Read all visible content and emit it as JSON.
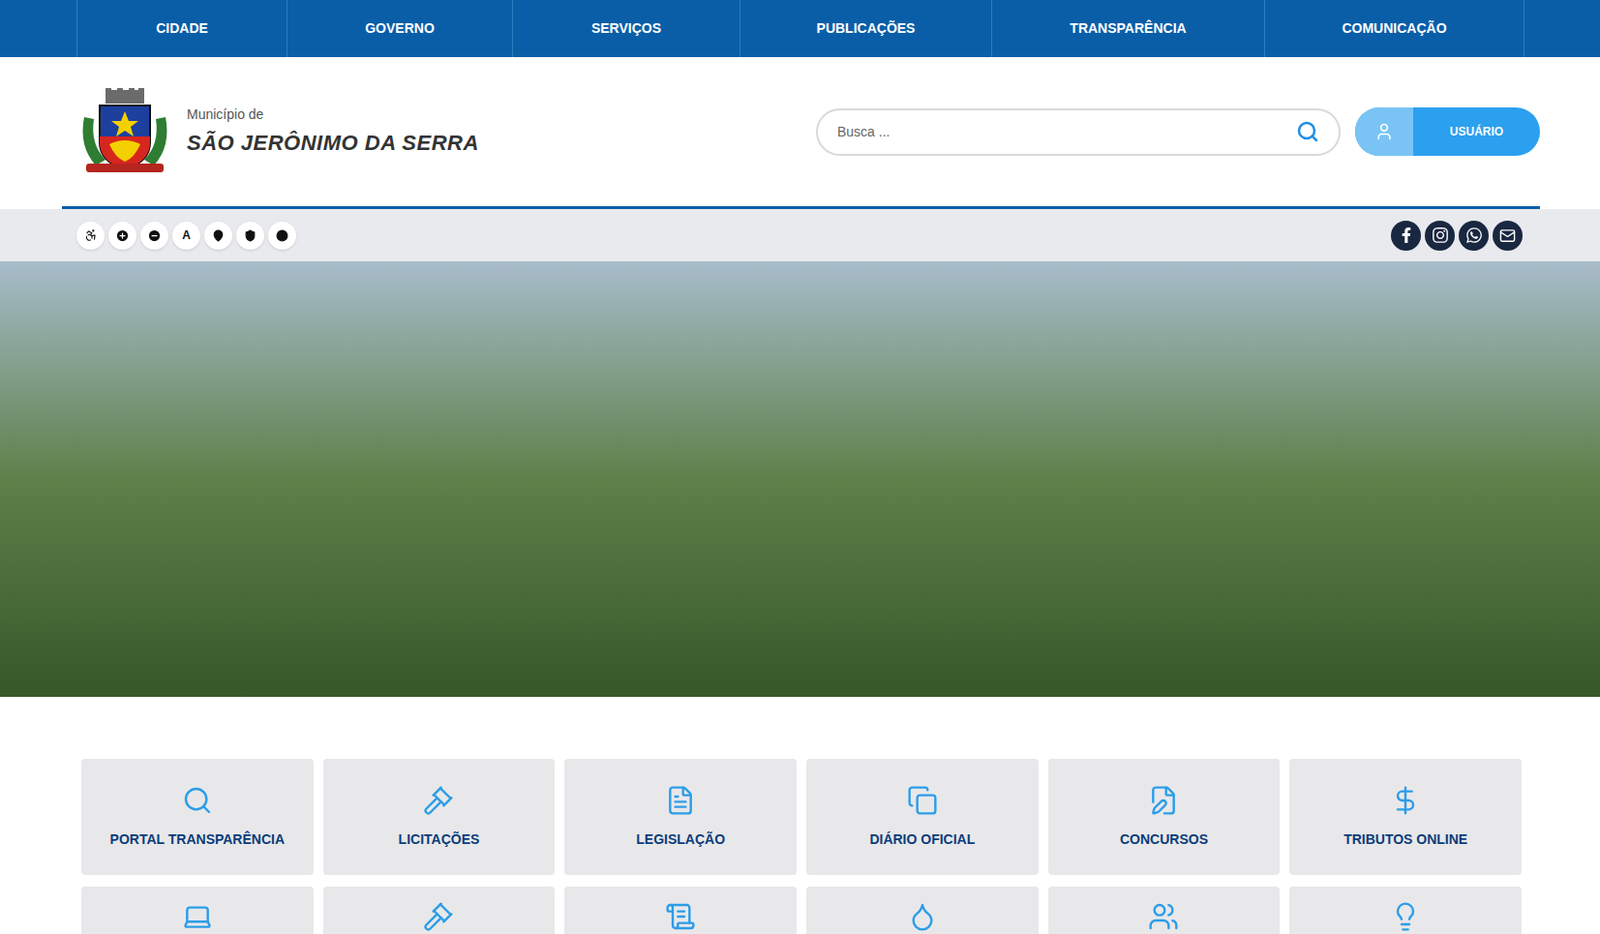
{
  "nav": [
    "CIDADE",
    "GOVERNO",
    "SERVIÇOS",
    "PUBLICAÇÕES",
    "TRANSPARÊNCIA",
    "COMUNICAÇÃO"
  ],
  "municipality": {
    "prefix": "Município de",
    "name": "SÃO JERÔNIMO DA SERRA"
  },
  "search": {
    "placeholder": "Busca ..."
  },
  "user_button": {
    "label": "USUÁRIO"
  },
  "accessibility": {
    "font_label": "A"
  },
  "tiles": [
    {
      "label": "PORTAL TRANSPARÊNCIA"
    },
    {
      "label": "LICITAÇÕES"
    },
    {
      "label": "LEGISLAÇÃO"
    },
    {
      "label": "DIÁRIO OFICIAL"
    },
    {
      "label": "CONCURSOS"
    },
    {
      "label": "TRIBUTOS ONLINE"
    }
  ]
}
